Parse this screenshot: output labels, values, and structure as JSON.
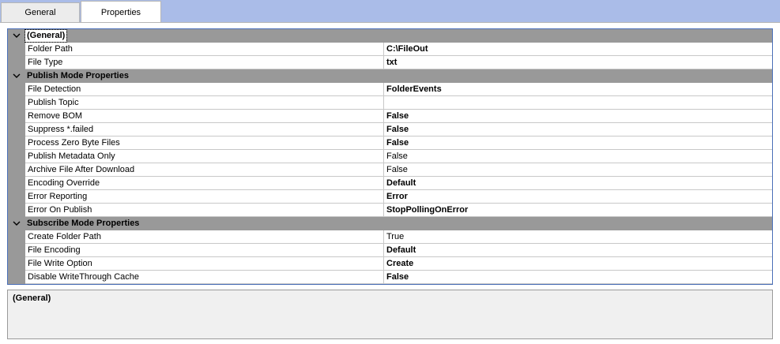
{
  "tabs": [
    {
      "label": "General",
      "active": false
    },
    {
      "label": "Properties",
      "active": true
    }
  ],
  "colors": {
    "tab_bar": "#aabce8",
    "category_band": "#999999",
    "grid_border": "#4a6fb8",
    "description_bg": "#f0f0f0"
  },
  "categories": [
    {
      "label": "(General)",
      "expanded": true,
      "properties": [
        {
          "name": "Folder Path",
          "value": "C:\\FileOut",
          "bold": true
        },
        {
          "name": "File Type",
          "value": "txt",
          "bold": true
        }
      ]
    },
    {
      "label": "Publish Mode Properties",
      "expanded": true,
      "properties": [
        {
          "name": "File Detection",
          "value": "FolderEvents",
          "bold": true
        },
        {
          "name": "Publish Topic",
          "value": "",
          "bold": false
        },
        {
          "name": "Remove BOM",
          "value": "False",
          "bold": true
        },
        {
          "name": "Suppress *.failed",
          "value": "False",
          "bold": true
        },
        {
          "name": "Process Zero Byte Files",
          "value": "False",
          "bold": true
        },
        {
          "name": "Publish Metadata Only",
          "value": "False",
          "bold": false
        },
        {
          "name": "Archive File After Download",
          "value": "False",
          "bold": false
        },
        {
          "name": "Encoding Override",
          "value": "Default",
          "bold": true
        },
        {
          "name": "Error Reporting",
          "value": "Error",
          "bold": true
        },
        {
          "name": "Error On Publish",
          "value": "StopPollingOnError",
          "bold": true
        }
      ]
    },
    {
      "label": "Subscribe Mode Properties",
      "expanded": true,
      "properties": [
        {
          "name": "Create Folder Path",
          "value": "True",
          "bold": false
        },
        {
          "name": "File Encoding",
          "value": "Default",
          "bold": true
        },
        {
          "name": "File Write Option",
          "value": "Create",
          "bold": true
        },
        {
          "name": "Disable WriteThrough Cache",
          "value": "False",
          "bold": true
        }
      ]
    }
  ],
  "description": {
    "title": "(General)"
  }
}
